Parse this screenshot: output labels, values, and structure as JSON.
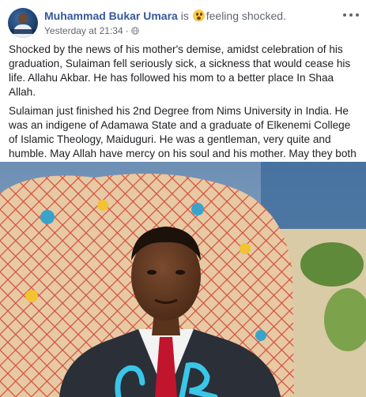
{
  "post": {
    "author": "Muhammad Bukar Umara",
    "feeling_prefix": "is",
    "feeling_text": "feeling shocked.",
    "feeling_icon": "shocked-face-icon",
    "timestamp": "Yesterday at 21:34",
    "dot_separator": "·",
    "privacy_icon": "globe-icon",
    "menu_icon": "more-options-icon",
    "paragraphs": [
      "Shocked by the news of his mother's demise, amidst celebration of his graduation, Sulaiman fell seriously sick, a sickness that would cease his life. Allahu Akbar. He has followed his mom to a better place In Shaa Allah.",
      "Sulaiman just finished his 2nd Degree from Nims University in India. He was an indigene of Adamawa State and a graduate of Elkenemi College of Islamic Theology, Maiduguri. He was a gentleman, very quite and humble. May Allah have mercy on his soul and his mother. May they both unite in Jannatul Firdausi. Ameen Ya Allah."
    ]
  },
  "colors": {
    "author_link": "#365899",
    "muted_text": "#616770",
    "body_text": "#1c1e21",
    "tie_red": "#c0152c",
    "suit_dark": "#2a2f38"
  }
}
